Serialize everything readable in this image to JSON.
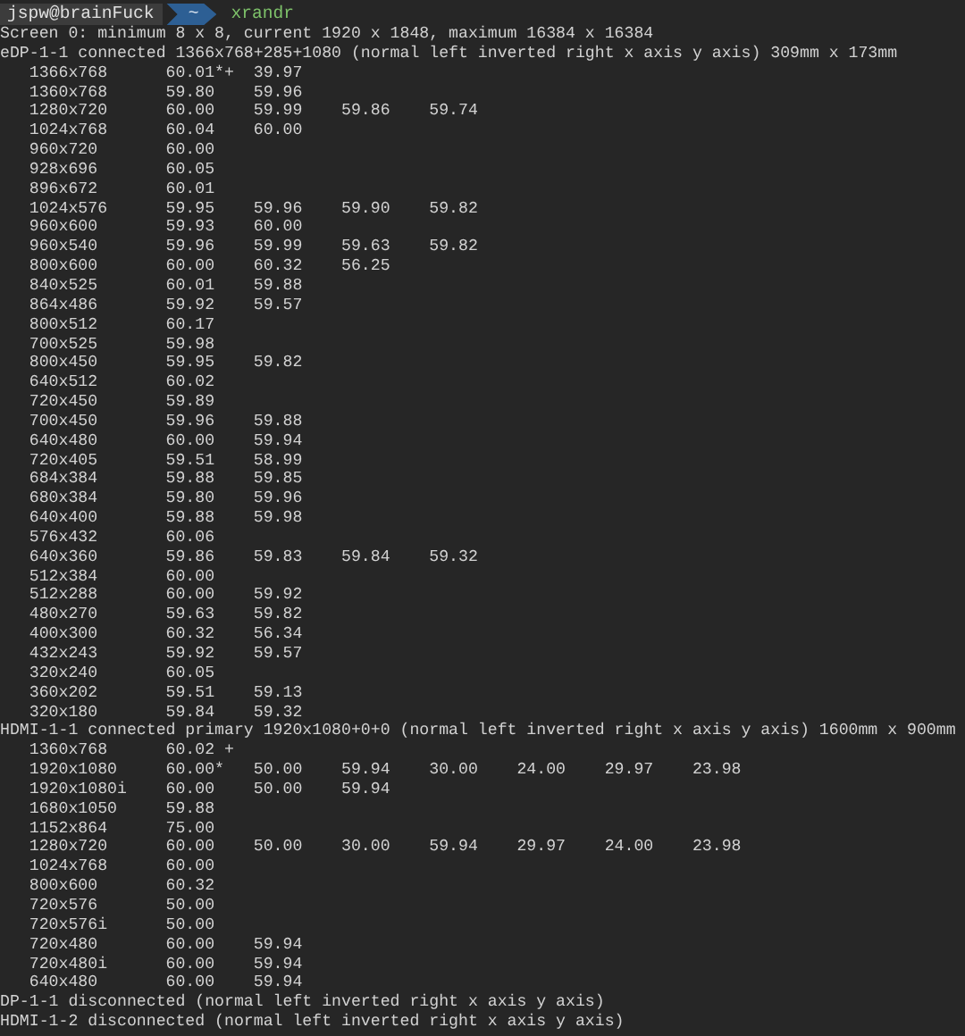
{
  "prompt": {
    "user_host": "jspw@brainFuck",
    "path": "~",
    "command": "xrandr"
  },
  "output": [
    {
      "kind": "text",
      "text": "Screen 0: minimum 8 x 8, current 1920 x 1848, maximum 16384 x 16384"
    },
    {
      "kind": "text",
      "text": "eDP-1-1 connected 1366x768+285+1080 (normal left inverted right x axis y axis) 309mm x 173mm"
    },
    {
      "kind": "mode",
      "resolution": "1366x768",
      "rates": [
        "60.01*+",
        "39.97"
      ]
    },
    {
      "kind": "mode",
      "resolution": "1360x768",
      "rates": [
        "59.80",
        "59.96"
      ]
    },
    {
      "kind": "mode",
      "resolution": "1280x720",
      "rates": [
        "60.00",
        "59.99",
        "59.86",
        "59.74"
      ]
    },
    {
      "kind": "mode",
      "resolution": "1024x768",
      "rates": [
        "60.04",
        "60.00"
      ]
    },
    {
      "kind": "mode",
      "resolution": "960x720",
      "rates": [
        "60.00"
      ]
    },
    {
      "kind": "mode",
      "resolution": "928x696",
      "rates": [
        "60.05"
      ]
    },
    {
      "kind": "mode",
      "resolution": "896x672",
      "rates": [
        "60.01"
      ]
    },
    {
      "kind": "mode",
      "resolution": "1024x576",
      "rates": [
        "59.95",
        "59.96",
        "59.90",
        "59.82"
      ]
    },
    {
      "kind": "mode",
      "resolution": "960x600",
      "rates": [
        "59.93",
        "60.00"
      ]
    },
    {
      "kind": "mode",
      "resolution": "960x540",
      "rates": [
        "59.96",
        "59.99",
        "59.63",
        "59.82"
      ]
    },
    {
      "kind": "mode",
      "resolution": "800x600",
      "rates": [
        "60.00",
        "60.32",
        "56.25"
      ]
    },
    {
      "kind": "mode",
      "resolution": "840x525",
      "rates": [
        "60.01",
        "59.88"
      ]
    },
    {
      "kind": "mode",
      "resolution": "864x486",
      "rates": [
        "59.92",
        "59.57"
      ]
    },
    {
      "kind": "mode",
      "resolution": "800x512",
      "rates": [
        "60.17"
      ]
    },
    {
      "kind": "mode",
      "resolution": "700x525",
      "rates": [
        "59.98"
      ]
    },
    {
      "kind": "mode",
      "resolution": "800x450",
      "rates": [
        "59.95",
        "59.82"
      ]
    },
    {
      "kind": "mode",
      "resolution": "640x512",
      "rates": [
        "60.02"
      ]
    },
    {
      "kind": "mode",
      "resolution": "720x450",
      "rates": [
        "59.89"
      ]
    },
    {
      "kind": "mode",
      "resolution": "700x450",
      "rates": [
        "59.96",
        "59.88"
      ]
    },
    {
      "kind": "mode",
      "resolution": "640x480",
      "rates": [
        "60.00",
        "59.94"
      ]
    },
    {
      "kind": "mode",
      "resolution": "720x405",
      "rates": [
        "59.51",
        "58.99"
      ]
    },
    {
      "kind": "mode",
      "resolution": "684x384",
      "rates": [
        "59.88",
        "59.85"
      ]
    },
    {
      "kind": "mode",
      "resolution": "680x384",
      "rates": [
        "59.80",
        "59.96"
      ]
    },
    {
      "kind": "mode",
      "resolution": "640x400",
      "rates": [
        "59.88",
        "59.98"
      ]
    },
    {
      "kind": "mode",
      "resolution": "576x432",
      "rates": [
        "60.06"
      ]
    },
    {
      "kind": "mode",
      "resolution": "640x360",
      "rates": [
        "59.86",
        "59.83",
        "59.84",
        "59.32"
      ]
    },
    {
      "kind": "mode",
      "resolution": "512x384",
      "rates": [
        "60.00"
      ]
    },
    {
      "kind": "mode",
      "resolution": "512x288",
      "rates": [
        "60.00",
        "59.92"
      ]
    },
    {
      "kind": "mode",
      "resolution": "480x270",
      "rates": [
        "59.63",
        "59.82"
      ]
    },
    {
      "kind": "mode",
      "resolution": "400x300",
      "rates": [
        "60.32",
        "56.34"
      ]
    },
    {
      "kind": "mode",
      "resolution": "432x243",
      "rates": [
        "59.92",
        "59.57"
      ]
    },
    {
      "kind": "mode",
      "resolution": "320x240",
      "rates": [
        "60.05"
      ]
    },
    {
      "kind": "mode",
      "resolution": "360x202",
      "rates": [
        "59.51",
        "59.13"
      ]
    },
    {
      "kind": "mode",
      "resolution": "320x180",
      "rates": [
        "59.84",
        "59.32"
      ]
    },
    {
      "kind": "text",
      "text": "HDMI-1-1 connected primary 1920x1080+0+0 (normal left inverted right x axis y axis) 1600mm x 900mm"
    },
    {
      "kind": "mode",
      "resolution": "1360x768",
      "rates": [
        "60.02 +"
      ]
    },
    {
      "kind": "mode",
      "resolution": "1920x1080",
      "rates": [
        "60.00*",
        "50.00",
        "59.94",
        "30.00",
        "24.00",
        "29.97",
        "23.98"
      ]
    },
    {
      "kind": "mode",
      "resolution": "1920x1080i",
      "rates": [
        "60.00",
        "50.00",
        "59.94"
      ]
    },
    {
      "kind": "mode",
      "resolution": "1680x1050",
      "rates": [
        "59.88"
      ]
    },
    {
      "kind": "mode",
      "resolution": "1152x864",
      "rates": [
        "75.00"
      ]
    },
    {
      "kind": "mode",
      "resolution": "1280x720",
      "rates": [
        "60.00",
        "50.00",
        "30.00",
        "59.94",
        "29.97",
        "24.00",
        "23.98"
      ]
    },
    {
      "kind": "mode",
      "resolution": "1024x768",
      "rates": [
        "60.00"
      ]
    },
    {
      "kind": "mode",
      "resolution": "800x600",
      "rates": [
        "60.32"
      ]
    },
    {
      "kind": "mode",
      "resolution": "720x576",
      "rates": [
        "50.00"
      ]
    },
    {
      "kind": "mode",
      "resolution": "720x576i",
      "rates": [
        "50.00"
      ]
    },
    {
      "kind": "mode",
      "resolution": "720x480",
      "rates": [
        "60.00",
        "59.94"
      ]
    },
    {
      "kind": "mode",
      "resolution": "720x480i",
      "rates": [
        "60.00",
        "59.94"
      ]
    },
    {
      "kind": "mode",
      "resolution": "640x480",
      "rates": [
        "60.00",
        "59.94"
      ]
    },
    {
      "kind": "text",
      "text": "DP-1-1 disconnected (normal left inverted right x axis y axis)"
    },
    {
      "kind": "text",
      "text": "HDMI-1-2 disconnected (normal left inverted right x axis y axis)"
    }
  ]
}
